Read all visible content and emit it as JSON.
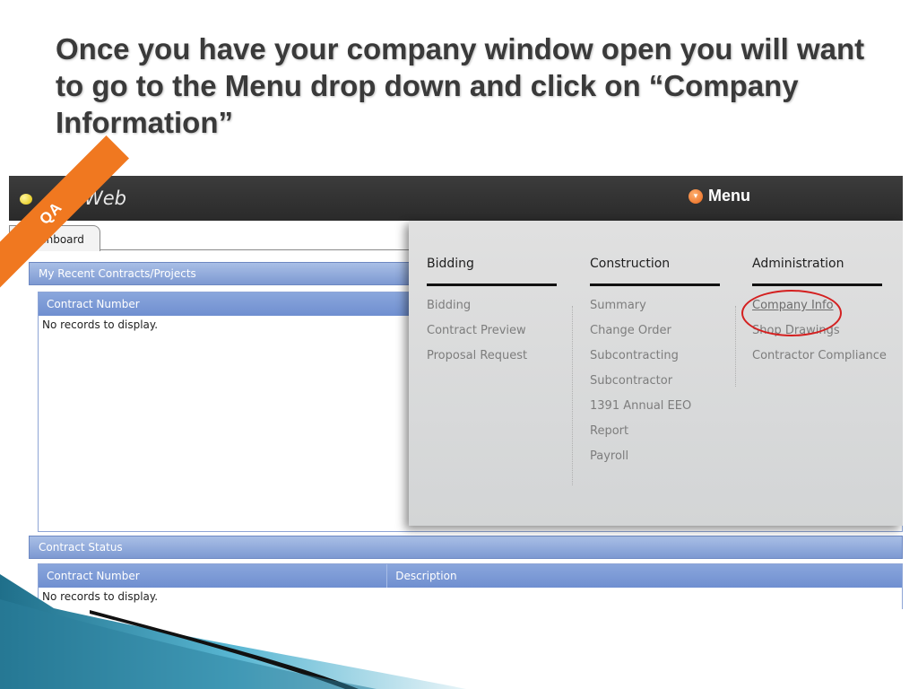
{
  "slide": {
    "title": "Once you have your company window open you will want to go to the Menu drop down and click on “Company Information”"
  },
  "app": {
    "name": "Web",
    "qa_badge": "QA",
    "menu_label": "Menu"
  },
  "tabs": [
    {
      "label": "ashboard"
    }
  ],
  "panels": {
    "recent": {
      "title": "My Recent Contracts/Projects",
      "columns": [
        "Contract Number"
      ],
      "empty_text": "No records to display."
    },
    "status": {
      "title": "Contract Status",
      "columns": [
        "Contract Number",
        "Description"
      ],
      "empty_text": "No records to display."
    }
  },
  "menu": {
    "columns": [
      {
        "heading": "Bidding",
        "items": [
          "Bidding",
          "Contract Preview",
          "Proposal Request"
        ]
      },
      {
        "heading": "Construction",
        "items": [
          "Summary",
          "Change Order",
          "Subcontracting",
          "Subcontractor",
          "1391 Annual EEO",
          "Report",
          "Payroll"
        ]
      },
      {
        "heading": "Administration",
        "items": [
          "Company Info",
          "Shop Drawings",
          "Contractor Compliance"
        ]
      }
    ],
    "highlighted_item": "Company Info"
  },
  "colors": {
    "ribbon": "#f07820",
    "topbar": "#2e2e2e",
    "panel_header": "#7d99d2",
    "highlight_circle": "#d42020"
  },
  "icons": {
    "logo": "logo-bulb-icon",
    "menu": "chevron-down-circle-icon"
  }
}
